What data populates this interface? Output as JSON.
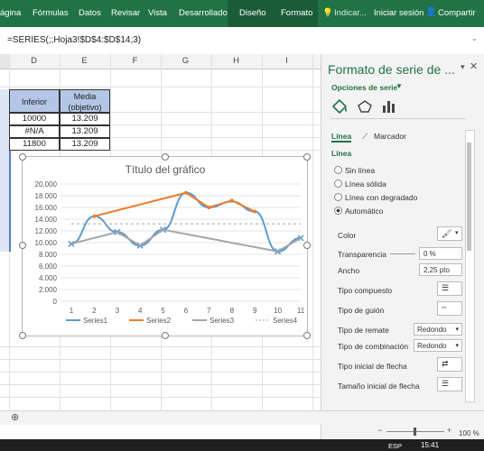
{
  "ribbon": {
    "tabs": [
      "ágina",
      "Fórmulas",
      "Datos",
      "Revisar",
      "Vista",
      "Desarrollador",
      "Diseño",
      "Formato"
    ],
    "tell_me": "Indicar...",
    "sign_in": "Iniciar sesión",
    "share": "Compartir"
  },
  "formula_bar": {
    "text": "=SERIES(;;Hoja3!$D$4:$D$14;3)"
  },
  "sheet": {
    "columns": [
      "D",
      "E",
      "F",
      "G",
      "H",
      "I"
    ],
    "header_d": "Inferior",
    "header_e": "Media (objetivo)",
    "rows": [
      {
        "d": "10000",
        "e": "13.209"
      },
      {
        "d": "#N/A",
        "e": "13.209"
      },
      {
        "d": "11800",
        "e": "13.209"
      }
    ]
  },
  "chart": {
    "title": "Título del gráfico",
    "y_ticks": [
      "20.000",
      "18.000",
      "16.000",
      "14.000",
      "12.000",
      "10.000",
      "8.000",
      "6.000",
      "4.000",
      "2.000",
      "0"
    ],
    "x_ticks": [
      "1",
      "2",
      "3",
      "4",
      "5",
      "6",
      "7",
      "8",
      "9",
      "10",
      "11"
    ],
    "legend": [
      "Series1",
      "Series2",
      "Series3",
      "Series4"
    ]
  },
  "chart_data": {
    "type": "line",
    "categories": [
      1,
      2,
      3,
      4,
      5,
      6,
      7,
      8,
      9,
      10,
      11
    ],
    "ylim": [
      0,
      20000
    ],
    "title": "Título del gráfico",
    "series": [
      {
        "name": "Series1",
        "values": [
          9800,
          14500,
          11800,
          9500,
          12200,
          18500,
          16000,
          17000,
          15300,
          8500,
          10800
        ],
        "color": "#5b9bd5"
      },
      {
        "name": "Series2",
        "values": [
          null,
          14500,
          null,
          null,
          null,
          18500,
          16000,
          17200,
          15300,
          null,
          null
        ],
        "color": "#ed7d31"
      },
      {
        "name": "Series3",
        "values": [
          9800,
          null,
          11800,
          9500,
          12200,
          null,
          null,
          null,
          null,
          8500,
          10800
        ],
        "color": "#a5a5a5"
      },
      {
        "name": "Series4",
        "values": [
          13209,
          13209,
          13209,
          13209,
          13209,
          13209,
          13209,
          13209,
          13209,
          13209,
          13209
        ],
        "color": "#a5a5a5"
      }
    ]
  },
  "pane": {
    "title": "Formato de serie de ...",
    "options_label": "Opciones de serie",
    "tab_linea": "Línea",
    "tab_marcador": "Marcador",
    "section": "Línea",
    "radios": [
      "Sin línea",
      "Línea sólida",
      "Línea con degradado",
      "Automático"
    ],
    "color_label": "Color",
    "transparency_label": "Transparencia",
    "transparency_value": "0 %",
    "width_label": "Ancho",
    "width_value": "2,25 pto",
    "compound_label": "Tipo compuesto",
    "dash_label": "Tipo de guión",
    "cap_label": "Tipo de remate",
    "cap_value": "Redondo",
    "join_label": "Tipo de combinación",
    "join_value": "Redondo",
    "arrow_begin_label": "Tipo inicial de flecha",
    "arrow_size_label": "Tamaño inicial de flecha"
  },
  "status": {
    "zoom": "100 %"
  },
  "taskbar": {
    "lang": "ESP",
    "time": "15:41"
  }
}
